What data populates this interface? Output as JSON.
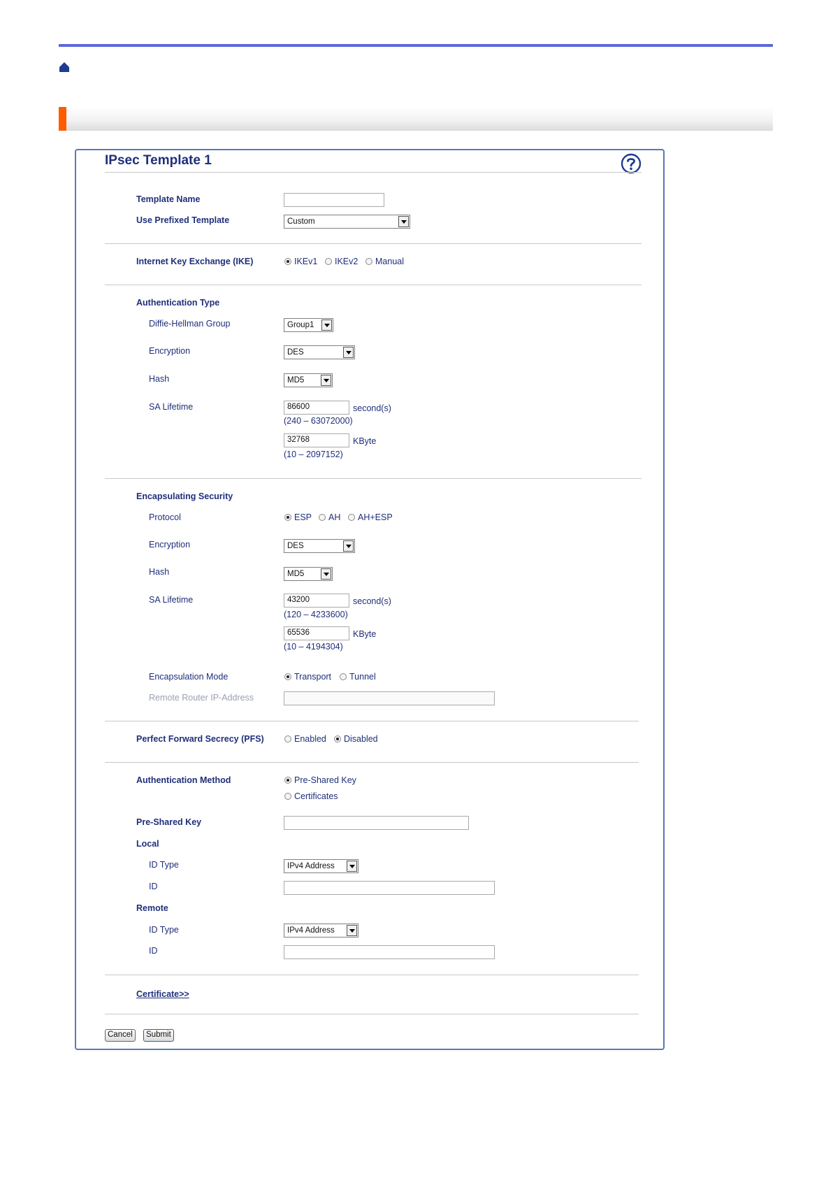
{
  "title": "IPsec Template 1",
  "general": {
    "template_name_label": "Template Name",
    "template_name_value": "",
    "use_prefixed_label": "Use Prefixed Template",
    "use_prefixed_value": "Custom"
  },
  "ike": {
    "label": "Internet Key Exchange (IKE)",
    "options": [
      "IKEv1",
      "IKEv2",
      "Manual"
    ],
    "selected": "IKEv1"
  },
  "auth_type": {
    "heading": "Authentication Type",
    "dh_label": "Diffie-Hellman Group",
    "dh_value": "Group1",
    "encryption_label": "Encryption",
    "encryption_value": "DES",
    "hash_label": "Hash",
    "hash_value": "MD5",
    "sa_label": "SA Lifetime",
    "sa_seconds_value": "86600",
    "sa_seconds_unit": "second(s)",
    "sa_seconds_range": "(240 – 63072000)",
    "sa_kbyte_value": "32768",
    "sa_kbyte_unit": "KByte",
    "sa_kbyte_range": "(10 – 2097152)"
  },
  "encap_security": {
    "heading": "Encapsulating Security",
    "protocol_label": "Protocol",
    "protocol_options": [
      "ESP",
      "AH",
      "AH+ESP"
    ],
    "protocol_selected": "ESP",
    "encryption_label": "Encryption",
    "encryption_value": "DES",
    "hash_label": "Hash",
    "hash_value": "MD5",
    "sa_label": "SA Lifetime",
    "sa_seconds_value": "43200",
    "sa_seconds_unit": "second(s)",
    "sa_seconds_range": "(120 – 4233600)",
    "sa_kbyte_value": "65536",
    "sa_kbyte_unit": "KByte",
    "sa_kbyte_range": "(10 – 4194304)",
    "mode_label": "Encapsulation Mode",
    "mode_options": [
      "Transport",
      "Tunnel"
    ],
    "mode_selected": "Transport",
    "remote_router_label": "Remote Router IP-Address",
    "remote_router_value": ""
  },
  "pfs": {
    "label": "Perfect Forward Secrecy (PFS)",
    "options": [
      "Enabled",
      "Disabled"
    ],
    "selected": "Disabled"
  },
  "auth_method": {
    "label": "Authentication Method",
    "options": [
      "Pre-Shared Key",
      "Certificates"
    ],
    "selected": "Pre-Shared Key",
    "psk_label": "Pre-Shared Key",
    "psk_value": "",
    "local_heading": "Local",
    "local_id_type_label": "ID Type",
    "local_id_type_value": "IPv4 Address",
    "local_id_label": "ID",
    "local_id_value": "",
    "remote_heading": "Remote",
    "remote_id_type_label": "ID Type",
    "remote_id_type_value": "IPv4 Address",
    "remote_id_label": "ID",
    "remote_id_value": ""
  },
  "certificate_link": "Certificate>>",
  "buttons": {
    "cancel": "Cancel",
    "submit": "Submit"
  }
}
